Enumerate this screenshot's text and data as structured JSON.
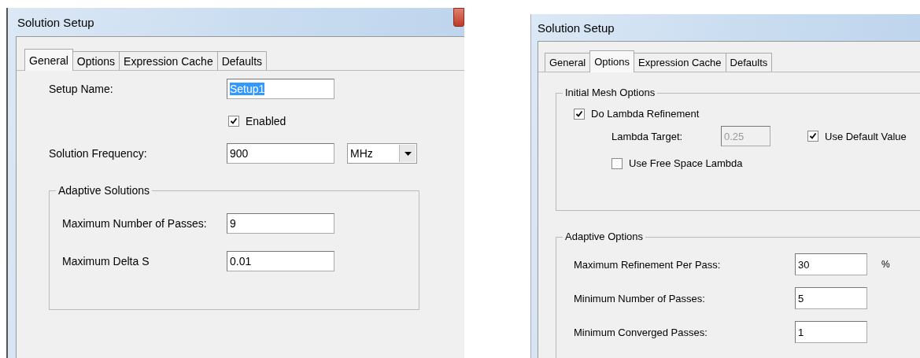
{
  "dialogs": [
    {
      "title": "Solution Setup",
      "close_button": true,
      "tabs": [
        {
          "label": "General",
          "selected": true
        },
        {
          "label": "Options",
          "selected": false
        },
        {
          "label": "Expression Cache",
          "selected": false
        },
        {
          "label": "Defaults",
          "selected": false
        }
      ],
      "items": [
        {
          "kind": "field",
          "label": "Setup Name:",
          "value": "Setup1",
          "highlighted": true
        },
        {
          "kind": "checkbox",
          "label": "Enabled",
          "checked": true
        },
        {
          "kind": "field",
          "label": "Solution Frequency:",
          "value": "900",
          "dropdown": "MHz"
        },
        {
          "kind": "group",
          "title": "Adaptive Solutions",
          "items": [
            {
              "kind": "field",
              "label": "Maximum Number of Passes:",
              "value": "9"
            },
            {
              "kind": "field",
              "label": "Maximum Delta S",
              "value": "0.01"
            }
          ]
        }
      ]
    },
    {
      "title": "Solution Setup",
      "tabs": [
        {
          "label": "General",
          "selected": false
        },
        {
          "label": "Options",
          "selected": true
        },
        {
          "label": "Expression Cache",
          "selected": false
        },
        {
          "label": "Defaults",
          "selected": false
        }
      ],
      "items": [
        {
          "kind": "group",
          "title": "Initial Mesh Options",
          "items": [
            {
              "kind": "checkbox",
              "label": "Do Lambda Refinement",
              "checked": true
            },
            {
              "kind": "field",
              "label": "Lambda Target:",
              "value": "0.25",
              "disabled": true,
              "checkbox": {
                "label": "Use Default Value",
                "checked": true
              }
            },
            {
              "kind": "checkbox",
              "label": "Use Free Space Lambda",
              "checked": false
            }
          ]
        },
        {
          "kind": "group",
          "title": "Adaptive Options",
          "items": [
            {
              "kind": "field",
              "label": "Maximum Refinement Per Pass:",
              "value": "30",
              "unit": "%"
            },
            {
              "kind": "field",
              "label": "Minimum Number of Passes:",
              "value": "5"
            },
            {
              "kind": "field",
              "label": "Minimum Converged Passes:",
              "value": "1"
            }
          ]
        }
      ]
    }
  ]
}
